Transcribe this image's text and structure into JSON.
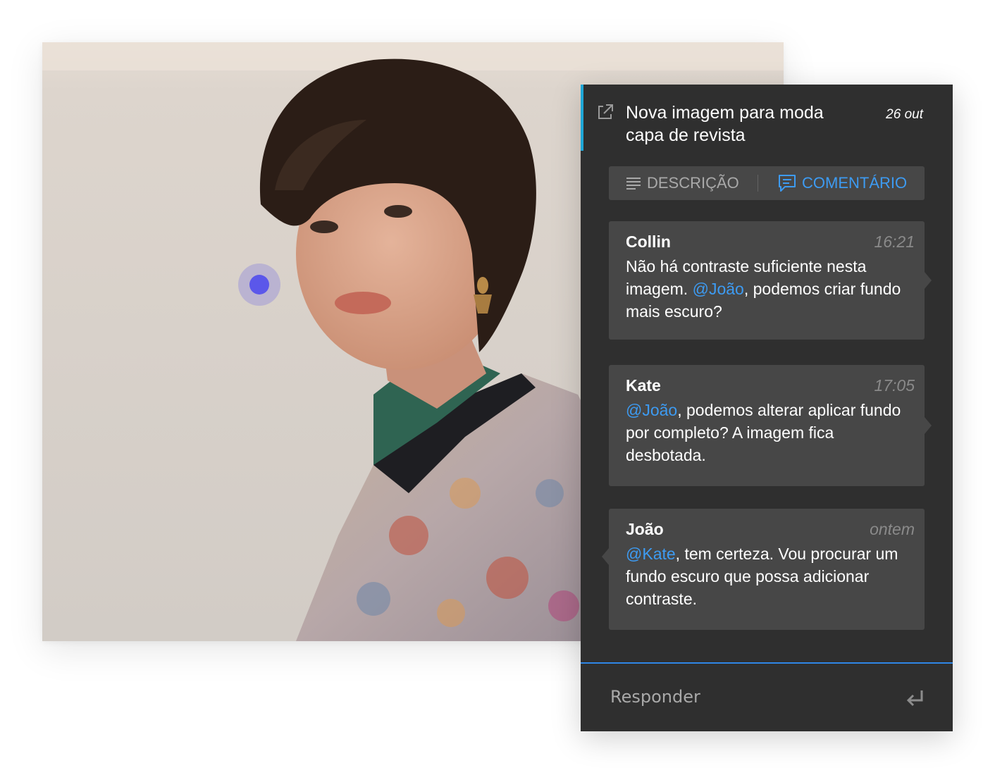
{
  "card": {
    "title_line1": "Nova imagem para moda",
    "title_line2": "capa de revista",
    "date": "26 out",
    "open_icon": "external-link-icon"
  },
  "tabs": [
    {
      "label": "DESCRIÇÃO",
      "icon": "lines-icon",
      "active": false
    },
    {
      "label": "COMENTÁRIO",
      "icon": "comment-icon",
      "active": true
    }
  ],
  "comments": [
    {
      "author": "Collin",
      "time": "16:21",
      "text_before": "Não há contraste suficiente nesta imagem. ",
      "mention": "@João",
      "text_after": ", podemos criar fundo mais escuro?"
    },
    {
      "author": "Kate",
      "time": "17:05",
      "text_before": "",
      "mention": "@João",
      "text_after": ", podemos alterar aplicar fundo por completo? A imagem fica desbotada."
    },
    {
      "author": "João",
      "time": "ontem",
      "text_before": "",
      "mention": "@Kate",
      "text_after": ", tem certeza. Vou procurar um fundo escuro que possa adicionar contraste."
    }
  ],
  "reply": {
    "placeholder": "Responder",
    "icon": "enter-icon"
  },
  "colors": {
    "panel_bg": "#2f2f2f",
    "bubble_bg": "#474747",
    "accent_blue": "#3d9bf2",
    "header_accent": "#1ea6d6",
    "marker": "#5b57ea"
  }
}
